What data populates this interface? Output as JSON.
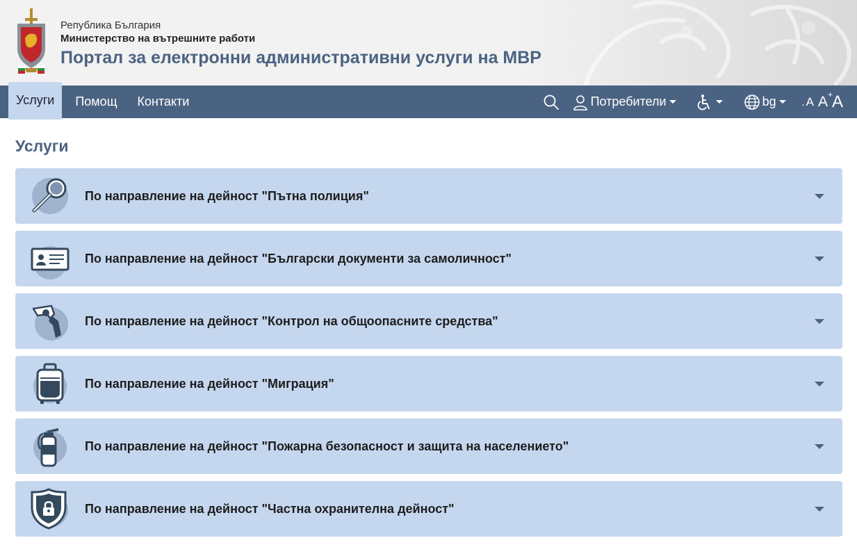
{
  "header": {
    "line1": "Република България",
    "line2": "Министерство на вътрешните работи",
    "title": "Портал за електронни административни услуги на МВР"
  },
  "nav": {
    "items": [
      {
        "label": "Услуги",
        "active": true
      },
      {
        "label": "Помощ",
        "active": false
      },
      {
        "label": "Контакти",
        "active": false
      }
    ],
    "users_label": "Потребители",
    "language": "bg",
    "icons": [
      "search-icon",
      "user-icon",
      "accessibility-icon",
      "globe-icon",
      "font-decrease-icon",
      "font-normal-icon",
      "font-increase-icon"
    ]
  },
  "main": {
    "title": "Услуги",
    "sections": [
      {
        "label": "По направление на дейност \"Пътна полиция\"",
        "icon": "magnifier-icon"
      },
      {
        "label": "По направление на дейност \"Български документи за самоличност\"",
        "icon": "id-card-icon"
      },
      {
        "label": "По направление на дейност \"Контрол на общоопасните средства\"",
        "icon": "revolver-icon"
      },
      {
        "label": "По направление на дейност \"Миграция\"",
        "icon": "suitcase-icon"
      },
      {
        "label": "По направление на дейност \"Пожарна безопасност и защита на населението\"",
        "icon": "fire-extinguisher-icon"
      },
      {
        "label": "По направление на дейност \"Частна охранителна дейност\"",
        "icon": "shield-lock-icon"
      }
    ]
  },
  "colors": {
    "nav_bg": "#4b6382",
    "accordion_bg": "#c5d7ef",
    "title_color": "#4b6382",
    "icon_circle": "#9fb3cd",
    "icon_dark": "#34495e"
  }
}
